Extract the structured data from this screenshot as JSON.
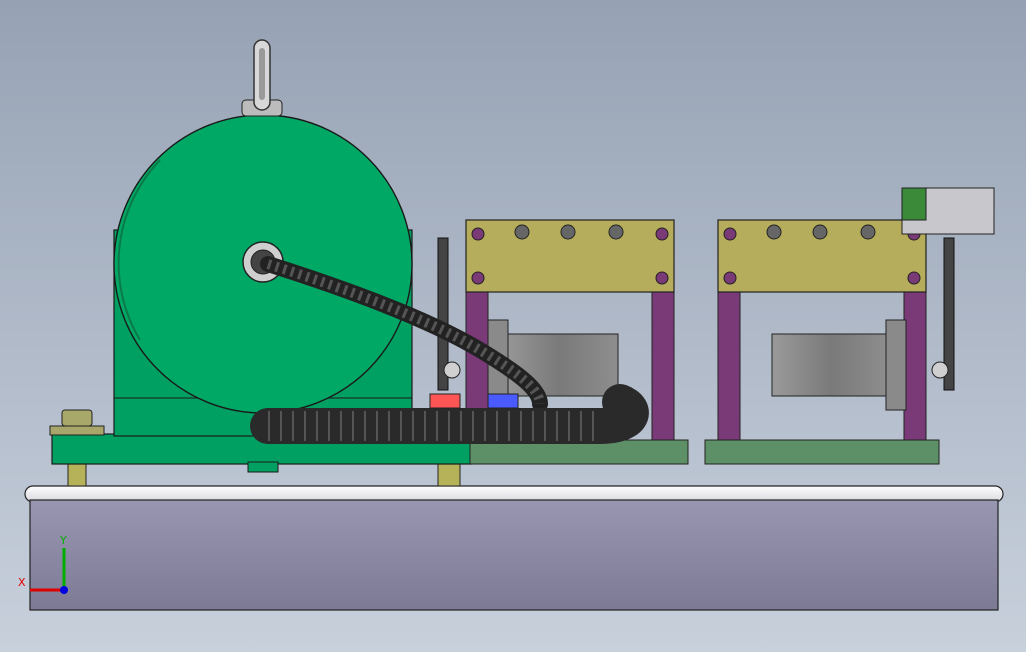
{
  "viewport": {
    "background_top": "#96a2b4",
    "background_bottom": "#c8d0dc"
  },
  "model": {
    "motor_color": "#00a063",
    "bracket_color": "#b5ad5c",
    "post_color": "#7a3a78",
    "base_color": "#82809a",
    "plate_color": "#5e9068"
  },
  "triad": {
    "x_label": "X",
    "y_label": "Y",
    "x_color": "#e00000",
    "y_color": "#00b000",
    "z_color": "#0000e0"
  }
}
